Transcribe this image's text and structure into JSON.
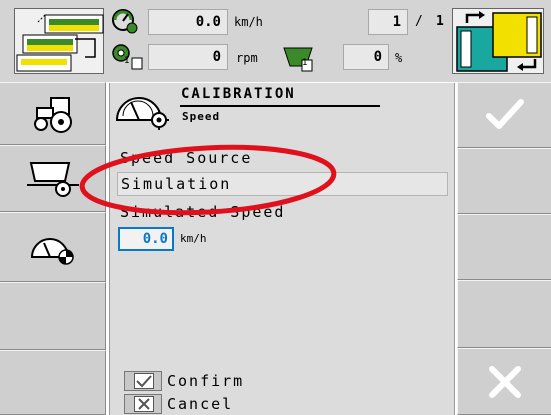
{
  "topbar": {
    "speed": {
      "value": "0.0",
      "unit": "km/h"
    },
    "rpm": {
      "value": "0",
      "unit": "rpm"
    },
    "tank_index": "1",
    "rpm_index": "1",
    "percent": {
      "value": "0",
      "unit": "%"
    },
    "page": {
      "current": "1",
      "separator": "/",
      "total": "1"
    }
  },
  "panel": {
    "title": "CALIBRATION",
    "subtitle": "Speed",
    "speed_source_label": "Speed Source",
    "speed_source_value": "Simulation",
    "simulated_speed_label": "Simulated Speed",
    "simulated_speed_value": "0.0",
    "simulated_speed_unit": "km/h",
    "confirm_label": "Confirm",
    "cancel_label": "Cancel"
  },
  "left_menu": {
    "items": [
      {
        "icon": "tractor-icon"
      },
      {
        "icon": "trailer-icon"
      },
      {
        "icon": "speedometer-icon"
      }
    ]
  },
  "right_menu": {
    "items": [
      {
        "icon": "checkmark-icon"
      },
      {
        "icon": "close-icon"
      }
    ]
  },
  "colors": {
    "accent": "#0a78c8",
    "annotation": "#e0101c",
    "panel_bg": "#dcdcdc",
    "button_bg": "#cfcfcf"
  }
}
